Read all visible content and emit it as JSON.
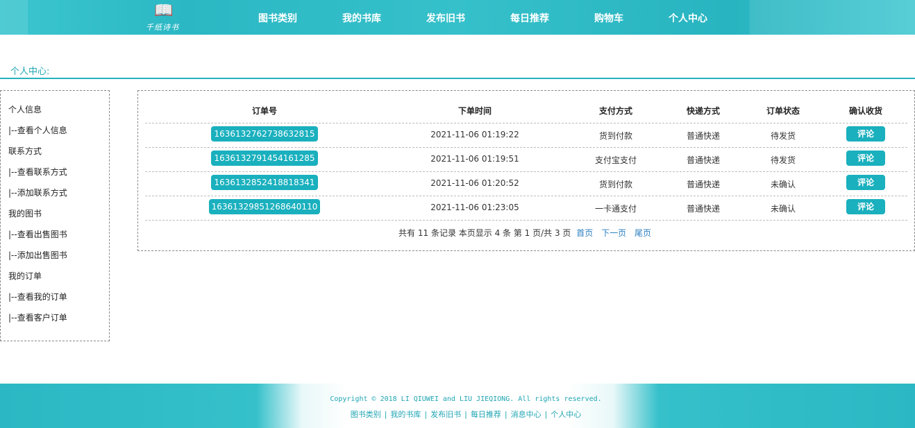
{
  "header": {
    "logo_text": "千纸诗书",
    "nav": [
      "图书类别",
      "我的书库",
      "发布旧书",
      "每日推荐",
      "购物车",
      "个人中心"
    ]
  },
  "section_title": "个人中心:",
  "sidebar": {
    "groups": [
      {
        "title": "个人信息",
        "links": [
          "|--查看个人信息"
        ]
      },
      {
        "title": "联系方式",
        "links": [
          "|--查看联系方式",
          "|--添加联系方式"
        ]
      },
      {
        "title": "我的图书",
        "links": [
          "|--查看出售图书",
          "|--添加出售图书"
        ]
      },
      {
        "title": "我的订单",
        "links": [
          "|--查看我的订单",
          "|--查看客户订单"
        ]
      }
    ]
  },
  "orders": {
    "columns": [
      "订单号",
      "下单时间",
      "支付方式",
      "快递方式",
      "订单状态",
      "确认收货"
    ],
    "rows": [
      {
        "order_no": "1636132762738632815",
        "time": "2021-11-06 01:19:22",
        "payment": "货到付款",
        "delivery": "普通快递",
        "status": "待发货",
        "action": "评论"
      },
      {
        "order_no": "1636132791454161285",
        "time": "2021-11-06 01:19:51",
        "payment": "支付宝支付",
        "delivery": "普通快递",
        "status": "待发货",
        "action": "评论"
      },
      {
        "order_no": "1636132852418818341",
        "time": "2021-11-06 01:20:52",
        "payment": "货到付款",
        "delivery": "普通快递",
        "status": "未确认",
        "action": "评论"
      },
      {
        "order_no": "1636132985126864011​0",
        "time": "2021-11-06 01:23:05",
        "payment": "一卡通支付",
        "delivery": "普通快递",
        "status": "未确认",
        "action": "评论"
      }
    ]
  },
  "pager": {
    "summary": "共有 11 条记录 本页显示 4 条 第 1 页/共 3 页",
    "first": "首页",
    "next": "下一页",
    "last": "尾页"
  },
  "footer": {
    "copyright": "Copyright © 2018 LI QIUWEI and LIU JIEQIONG. All rights reserved.",
    "links": [
      "图书类别",
      "我的书库",
      "发布旧书",
      "每日推荐",
      "消息中心",
      "个人中心"
    ],
    "separator": "|"
  },
  "colors": {
    "accent": "#1ab0be",
    "accent_text": "#1fa5b3",
    "link": "#2b7fc0"
  }
}
